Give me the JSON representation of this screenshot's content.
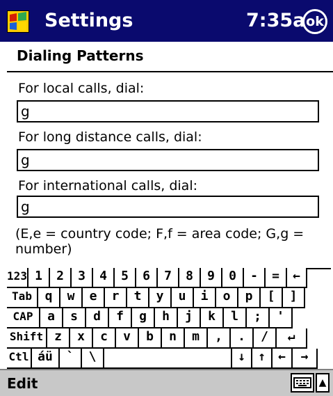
{
  "titlebar": {
    "title": "Settings",
    "time": "7:35a",
    "ok_label": "ok"
  },
  "page": {
    "heading": "Dialing Patterns"
  },
  "form": {
    "local_label": "For local calls, dial:",
    "local_value": "g",
    "long_distance_label": "For long distance calls, dial:",
    "long_distance_value": "g",
    "international_label": "For international calls, dial:",
    "international_value": "g",
    "note": "(E,e = country code; F,f = area code; G,g = number)"
  },
  "keyboard": {
    "rows": [
      [
        "123",
        "1",
        "2",
        "3",
        "4",
        "5",
        "6",
        "7",
        "8",
        "9",
        "0",
        "-",
        "=",
        "←"
      ],
      [
        "Tab",
        "q",
        "w",
        "e",
        "r",
        "t",
        "y",
        "u",
        "i",
        "o",
        "p",
        "[",
        "]"
      ],
      [
        "CAP",
        "a",
        "s",
        "d",
        "f",
        "g",
        "h",
        "j",
        "k",
        "l",
        ";",
        "'"
      ],
      [
        "Shift",
        "z",
        "x",
        "c",
        "v",
        "b",
        "n",
        "m",
        ",",
        ".",
        "/",
        "↵"
      ],
      [
        "Ctl",
        "áü",
        "`",
        "\\",
        "",
        "↓",
        "↑",
        "←",
        "→"
      ]
    ]
  },
  "menubar": {
    "edit_label": "Edit",
    "sip_icon": "keyboard-icon",
    "sip_arrow": "▲"
  }
}
